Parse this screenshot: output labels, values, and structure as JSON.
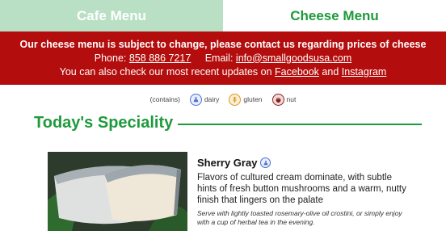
{
  "tabs": [
    {
      "label": "Cafe Menu",
      "active": false
    },
    {
      "label": "Cheese Menu",
      "active": true
    }
  ],
  "banner": {
    "notice": "Our cheese menu is subject to change, please contact us regarding prices of cheese",
    "phone_label": "Phone:",
    "phone_number": "858 886 7217",
    "email_label": "Email:",
    "email_address": "info@smallgoodsusa.com",
    "updates_prefix": "You can also check our most recent updates on",
    "facebook": "Facebook",
    "and": "and",
    "instagram": "Instagram"
  },
  "legend": {
    "intro": "(contains)",
    "items": [
      {
        "label": "dairy",
        "icon": "dairy-icon"
      },
      {
        "label": "gluten",
        "icon": "gluten-icon"
      },
      {
        "label": "nut",
        "icon": "nut-icon"
      }
    ]
  },
  "section": {
    "title": "Today's Speciality"
  },
  "product": {
    "name": "Sherry Gray",
    "allergens": [
      "dairy"
    ],
    "description": "Flavors of cultured cream dominate, with subtle hints of fresh button mushrooms and a warm, nutty finish that lingers on the palate",
    "serving": "Serve with lightly toasted rosemary-olive oil crostini, or simply enjoy with a cup of herbal tea in the evening."
  },
  "colors": {
    "brand_green": "#1e9a3c",
    "banner_red": "#b30d0d",
    "tab_inactive": "#b9e0c4"
  }
}
